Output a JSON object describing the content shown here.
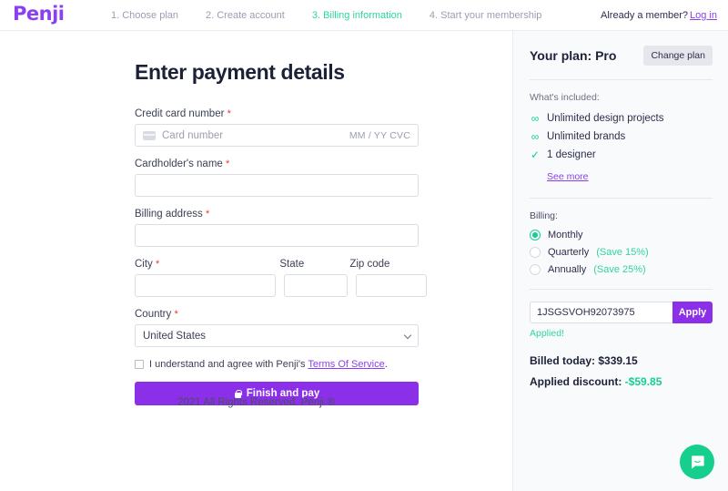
{
  "brand": {
    "logo_text": "Penji",
    "accent_purple": "#8b2fe8",
    "accent_green": "#16cf8f"
  },
  "header": {
    "steps": [
      {
        "label": "1. Choose plan",
        "active": false
      },
      {
        "label": "2. Create account",
        "active": false
      },
      {
        "label": "3. Billing information",
        "active": true
      },
      {
        "label": "4. Start your membership",
        "active": false
      }
    ],
    "member_prompt": "Already a member?",
    "login_label": "Log in"
  },
  "main": {
    "title": "Enter payment details",
    "fields": {
      "card_label": "Credit card number",
      "card_placeholder": "Card number",
      "card_meta": "MM / YY  CVC",
      "cardholder_label": "Cardholder's name",
      "cardholder_value": "",
      "address_label": "Billing address",
      "address_value": "",
      "city_label": "City",
      "city_value": "",
      "state_label": "State",
      "state_value": "",
      "zip_label": "Zip code",
      "zip_value": "",
      "country_label": "Country",
      "country_value": "United States",
      "required_mark": "*"
    },
    "terms": {
      "text_before": "I understand and agree with Penji's ",
      "link": "Terms Of Service",
      "text_after": ".",
      "checked": false
    },
    "pay_button": "Finish and pay",
    "footer": "2021 All Rights Reserved. Penji ®"
  },
  "sidebar": {
    "plan_title": "Your plan: Pro",
    "change_plan_label": "Change plan",
    "included_label": "What's included:",
    "features": [
      {
        "icon": "infinity-icon",
        "glyph": "∞",
        "label": "Unlimited design projects"
      },
      {
        "icon": "infinity-icon",
        "glyph": "∞",
        "label": "Unlimited brands"
      },
      {
        "icon": "check-icon",
        "glyph": "✓",
        "label": "1 designer"
      }
    ],
    "see_more_label": "See more",
    "billing_label": "Billing:",
    "billing_options": [
      {
        "label": "Monthly",
        "save": "",
        "selected": true
      },
      {
        "label": "Quarterly",
        "save": "(Save 15%)",
        "selected": false
      },
      {
        "label": "Annually",
        "save": "(Save 25%)",
        "selected": false
      }
    ],
    "promo_value": "1JSGSVOH92073975",
    "apply_label": "Apply",
    "applied_status": "Applied!",
    "billed_today_label": "Billed today: ",
    "billed_today_value": "$339.15",
    "discount_label": "Applied discount: ",
    "discount_value": "-$59.85"
  },
  "chat": {
    "icon": "chat-bubble-icon"
  }
}
